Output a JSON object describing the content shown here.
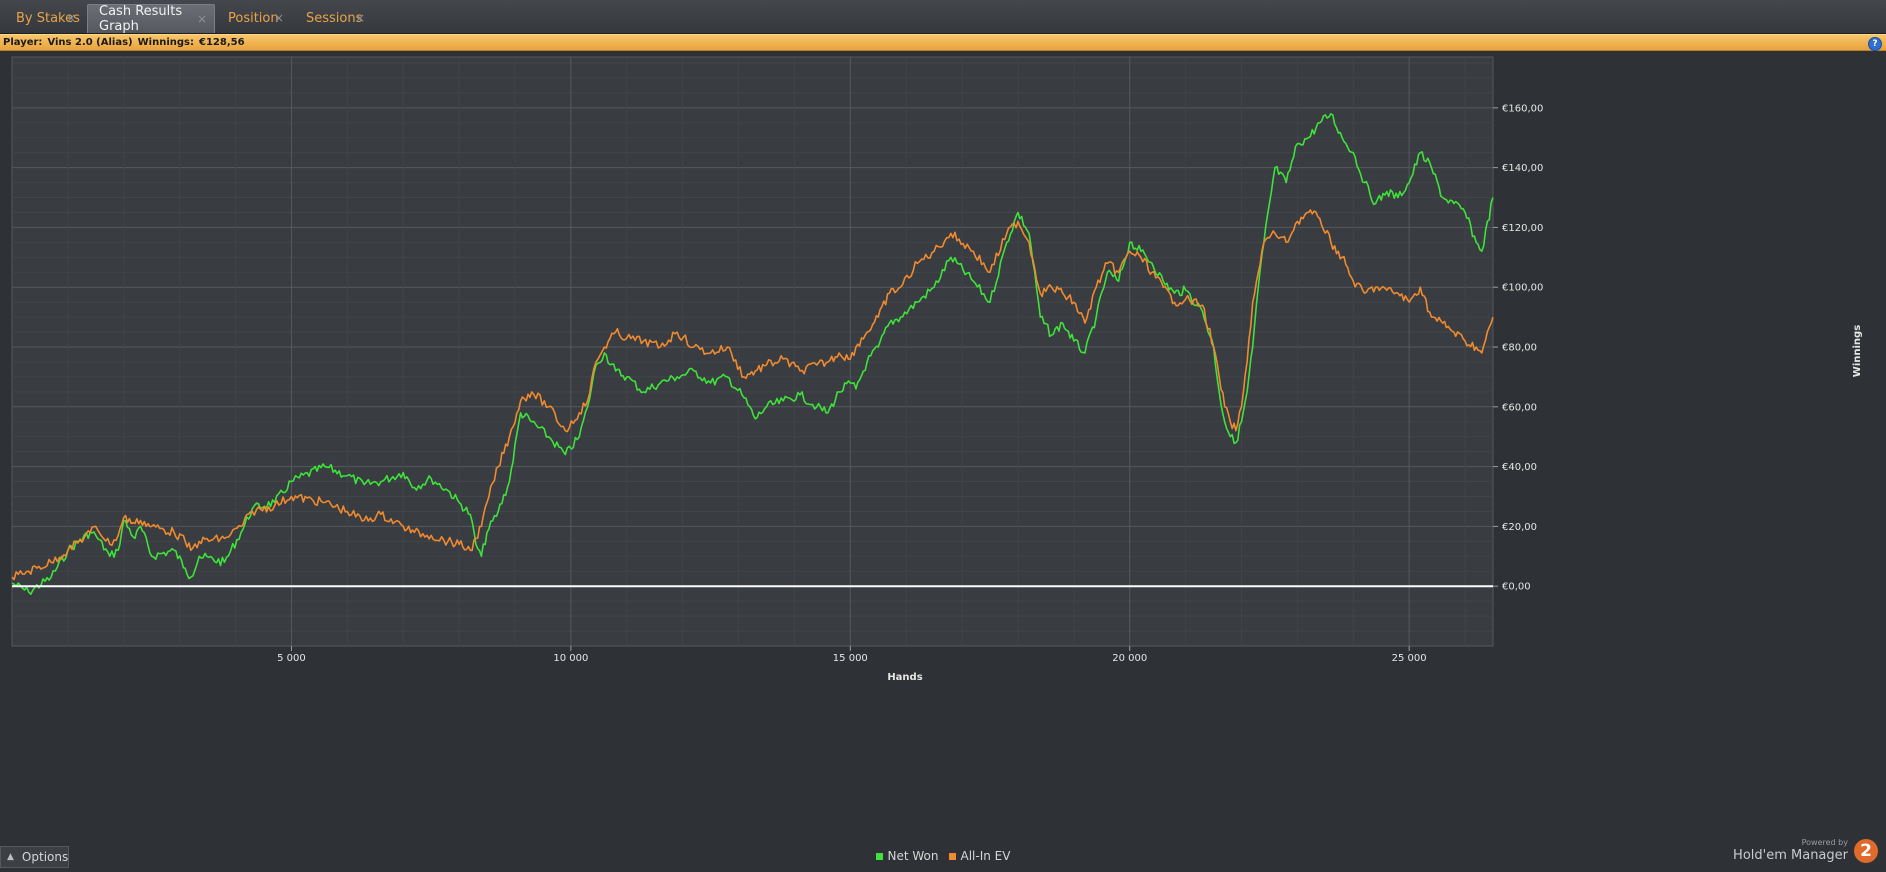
{
  "tabs": [
    {
      "label": "By Stakes",
      "active": false
    },
    {
      "label": "Cash Results Graph",
      "active": true
    },
    {
      "label": "Position",
      "active": false
    },
    {
      "label": "Sessions",
      "active": false
    }
  ],
  "tab_close_glyph": "×",
  "infobar": {
    "player_label": "Player:",
    "player_name": "Vins 2.0 (Alias)",
    "winnings_label": "Winnings:",
    "winnings_value": "€128,56",
    "help_icon": "?"
  },
  "options_label": "Options",
  "brand": {
    "powered_by": "Powered by",
    "name": "Hold'em Manager",
    "logo_text": "2"
  },
  "colors": {
    "net_won": "#3ee23a",
    "all_in_ev": "#f08a30",
    "zero_line": "#ffffff",
    "plot_bg": "#393c40",
    "grid": "#4d5055"
  },
  "chart_data": {
    "type": "line",
    "xlabel": "Hands",
    "ylabel": "Winnings",
    "xlim": [
      0,
      26500
    ],
    "ylim": [
      -20,
      177
    ],
    "x_ticks": [
      5000,
      10000,
      15000,
      20000,
      25000
    ],
    "x_tick_labels": [
      "5 000",
      "10 000",
      "15 000",
      "20 000",
      "25 000"
    ],
    "y_ticks": [
      0,
      20,
      40,
      60,
      80,
      100,
      120,
      140,
      160
    ],
    "y_tick_labels": [
      "€0,00",
      "€20,00",
      "€40,00",
      "€60,00",
      "€80,00",
      "€100,00",
      "€120,00",
      "€140,00",
      "€160,00"
    ],
    "grid": true,
    "legend": "bottom-center",
    "series": [
      {
        "name": "Net Won",
        "x": [
          0,
          300,
          700,
          1000,
          1400,
          1500,
          1750,
          1900,
          2000,
          2200,
          2300,
          2500,
          2900,
          3100,
          3200,
          3350,
          3800,
          4100,
          4300,
          4700,
          5000,
          5600,
          6000,
          6300,
          6600,
          7000,
          7200,
          7500,
          7800,
          8000,
          8200,
          8300,
          8400,
          8500,
          8700,
          8900,
          9100,
          9300,
          9600,
          9900,
          10150,
          10300,
          10450,
          10600,
          10800,
          11000,
          11300,
          11600,
          11900,
          12200,
          12500,
          12800,
          13100,
          13300,
          13500,
          13800,
          14100,
          14400,
          14600,
          14800,
          15000,
          15100,
          15300,
          15500,
          15700,
          15900,
          16200,
          16500,
          16800,
          17200,
          17500,
          17800,
          18000,
          18200,
          18400,
          18600,
          18800,
          19000,
          19200,
          19400,
          19600,
          19800,
          20000,
          20200,
          20400,
          20600,
          20800,
          21000,
          21300,
          21500,
          21600,
          21700,
          21800,
          21900,
          22000,
          22100,
          22200,
          22300,
          22400,
          22600,
          22800,
          23000,
          23200,
          23400,
          23600,
          23800,
          24000,
          24200,
          24400,
          24600,
          24800,
          25000,
          25200,
          25400,
          25600,
          25800,
          26000,
          26200,
          26300,
          26500
        ],
        "y": [
          1,
          -2,
          3,
          12,
          18,
          17,
          10,
          12,
          22,
          16,
          20,
          10,
          12,
          6,
          3,
          10,
          8,
          18,
          26,
          28,
          35,
          40,
          37,
          34,
          35,
          38,
          33,
          36,
          32,
          28,
          24,
          14,
          10,
          18,
          25,
          35,
          58,
          55,
          50,
          44,
          50,
          60,
          74,
          78,
          72,
          70,
          65,
          68,
          70,
          72,
          68,
          70,
          63,
          56,
          60,
          62,
          64,
          60,
          58,
          65,
          68,
          66,
          75,
          80,
          88,
          90,
          95,
          100,
          110,
          102,
          95,
          115,
          125,
          118,
          90,
          84,
          88,
          82,
          78,
          90,
          105,
          102,
          115,
          112,
          108,
          102,
          98,
          99,
          92,
          80,
          65,
          55,
          50,
          48,
          55,
          65,
          80,
          100,
          115,
          140,
          135,
          148,
          150,
          155,
          158,
          150,
          145,
          135,
          128,
          132,
          130,
          135,
          145,
          140,
          130,
          128,
          125,
          115,
          112,
          130
        ]
      },
      {
        "name": "All-In EV",
        "x": [
          0,
          300,
          700,
          1000,
          1400,
          1500,
          1750,
          1900,
          2000,
          2200,
          2300,
          2500,
          2900,
          3100,
          3200,
          3350,
          3800,
          4100,
          4300,
          4700,
          5000,
          5600,
          6000,
          6300,
          6600,
          7000,
          7200,
          7500,
          7800,
          8000,
          8200,
          8300,
          8400,
          8500,
          8700,
          8900,
          9100,
          9300,
          9600,
          9900,
          10150,
          10300,
          10450,
          10600,
          10800,
          11000,
          11300,
          11600,
          11900,
          12200,
          12500,
          12800,
          13100,
          13300,
          13500,
          13800,
          14100,
          14400,
          14600,
          14800,
          15000,
          15100,
          15300,
          15500,
          15700,
          15900,
          16200,
          16500,
          16800,
          17200,
          17500,
          17800,
          18000,
          18200,
          18400,
          18600,
          18800,
          19000,
          19200,
          19400,
          19600,
          19800,
          20000,
          20200,
          20400,
          20600,
          20800,
          21000,
          21300,
          21500,
          21600,
          21700,
          21800,
          21900,
          22000,
          22100,
          22200,
          22300,
          22400,
          22600,
          22800,
          23000,
          23200,
          23400,
          23600,
          23800,
          24000,
          24200,
          24400,
          24600,
          24800,
          25000,
          25200,
          25400,
          25600,
          25800,
          26000,
          26200,
          26300,
          26500
        ],
        "y": [
          3,
          5,
          8,
          12,
          18,
          20,
          14,
          17,
          23,
          21,
          22,
          20,
          18,
          15,
          12,
          15,
          16,
          20,
          25,
          27,
          30,
          28,
          25,
          22,
          24,
          20,
          18,
          17,
          15,
          14,
          12,
          16,
          20,
          28,
          40,
          50,
          62,
          65,
          60,
          52,
          58,
          62,
          75,
          80,
          85,
          83,
          82,
          80,
          85,
          80,
          78,
          80,
          70,
          72,
          74,
          76,
          72,
          74,
          75,
          78,
          76,
          80,
          85,
          90,
          98,
          100,
          108,
          112,
          118,
          112,
          105,
          118,
          122,
          115,
          98,
          100,
          98,
          95,
          88,
          100,
          108,
          105,
          112,
          110,
          105,
          100,
          95,
          96,
          94,
          80,
          70,
          60,
          55,
          52,
          60,
          75,
          95,
          105,
          115,
          118,
          115,
          122,
          125,
          123,
          115,
          110,
          102,
          98,
          100,
          99,
          98,
          95,
          100,
          90,
          88,
          85,
          82,
          80,
          78,
          90
        ]
      }
    ]
  }
}
